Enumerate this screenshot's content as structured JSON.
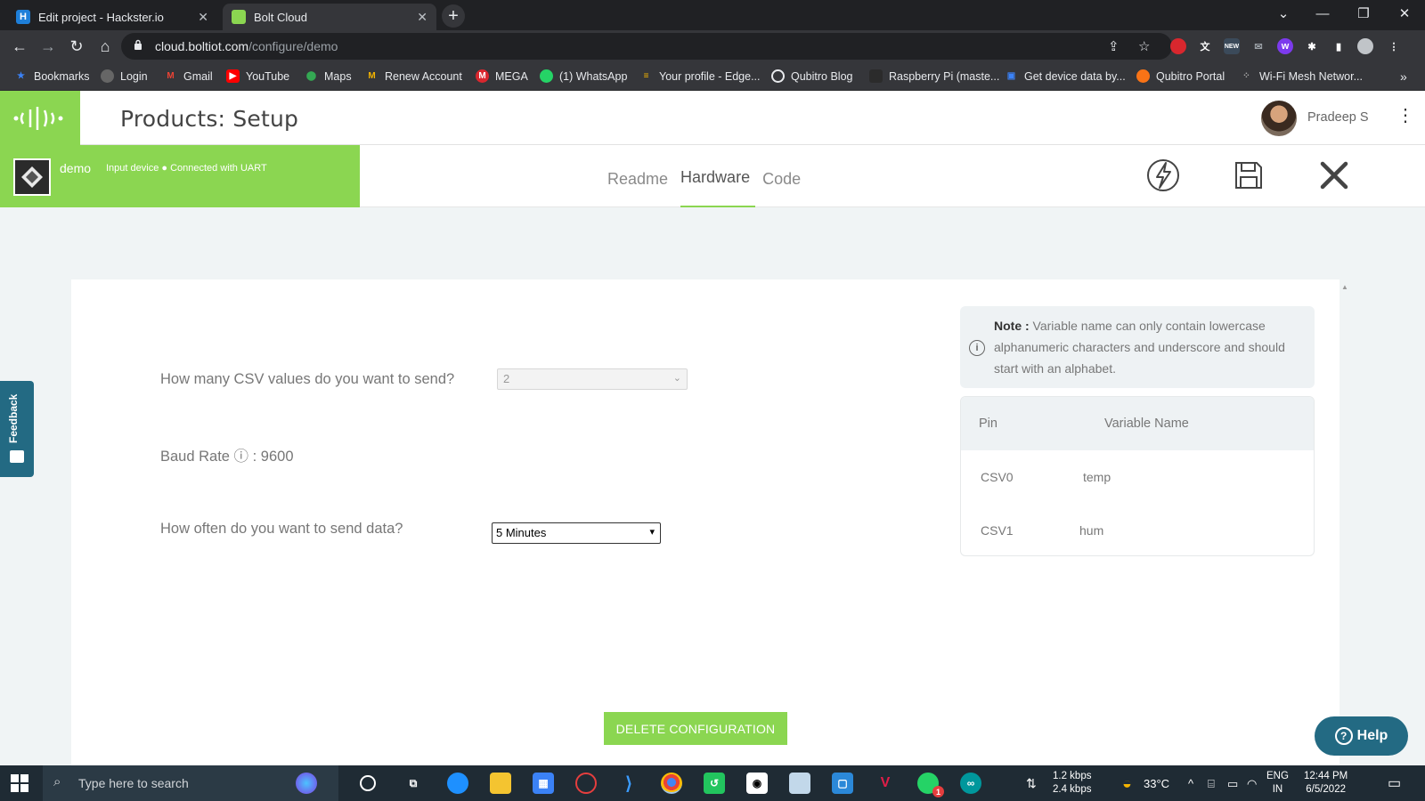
{
  "browser": {
    "tabs": [
      {
        "title": "Edit project - Hackster.io",
        "favicon": "H",
        "color": "#1e7fd9"
      },
      {
        "title": "Bolt Cloud",
        "favicon": "",
        "color": "#8bd651"
      }
    ],
    "url_host": "cloud.boltiot.com",
    "url_path": "/configure/demo",
    "bookmarks": [
      {
        "label": "Bookmarks",
        "icon": "star-icon",
        "color": "#3b82f6"
      },
      {
        "label": "Login",
        "icon": "globe-icon",
        "color": "#666"
      },
      {
        "label": "Gmail",
        "icon": "gmail-icon",
        "color": "#ea4335"
      },
      {
        "label": "YouTube",
        "icon": "youtube-icon",
        "color": "#ff0000"
      },
      {
        "label": "Maps",
        "icon": "maps-icon",
        "color": "#34a853"
      },
      {
        "label": "Renew Account",
        "icon": "renew-icon",
        "color": "#f4b400"
      },
      {
        "label": "MEGA",
        "icon": "mega-icon",
        "color": "#d9272e"
      },
      {
        "label": "(1) WhatsApp",
        "icon": "whatsapp-icon",
        "color": "#25d366"
      },
      {
        "label": "Your profile - Edge...",
        "icon": "edge-profile-icon",
        "color": "#f4b400"
      },
      {
        "label": "Qubitro Blog",
        "icon": "qubitro-blog-icon",
        "color": "#222"
      },
      {
        "label": "Raspberry Pi (maste...",
        "icon": "raspberry-icon",
        "color": "#2b2b2b"
      },
      {
        "label": "Get device data by...",
        "icon": "book-icon",
        "color": "#3b82f6"
      },
      {
        "label": "Qubitro Portal",
        "icon": "qubitro-portal-icon",
        "color": "#f97316"
      },
      {
        "label": "Wi-Fi Mesh Networ...",
        "icon": "mesh-icon",
        "color": "#555"
      }
    ]
  },
  "app": {
    "page_title": "Products: Setup",
    "user_name": "Pradeep S",
    "device_name": "demo",
    "device_status": "Input device ● Connected with UART",
    "tabs": [
      "Readme",
      "Hardware",
      "Code"
    ],
    "active_tab": "Hardware"
  },
  "form": {
    "csv_question": "How many CSV values do you want to send?",
    "csv_value": "2",
    "baud_label": "Baud Rate ⓘ : 9600",
    "frequency_question": "How often do you want to send data?",
    "frequency_value": "5 Minutes"
  },
  "note": {
    "title": "Note :",
    "text": " Variable name can only contain lowercase alphanumeric characters and underscore and should start with an alphabet."
  },
  "pin_table": {
    "headers": [
      "Pin",
      "Variable Name"
    ],
    "rows": [
      {
        "pin": "CSV0",
        "name": "temp"
      },
      {
        "pin": "CSV1",
        "name": "hum"
      }
    ]
  },
  "actions": {
    "delete_label": "DELETE CONFIGURATION",
    "help_label": "Help",
    "feedback_label": "Feedback"
  },
  "taskbar": {
    "search_placeholder": "Type here to search",
    "net_down": "1.2 kbps",
    "net_up": "2.4 kbps",
    "temperature": "33°C",
    "lang": "ENG",
    "region": "IN",
    "time": "12:44 PM",
    "date": "6/5/2022",
    "notification_badge": "1"
  },
  "colors": {
    "brand_green": "#8bd651",
    "help_blue": "#236a83"
  }
}
